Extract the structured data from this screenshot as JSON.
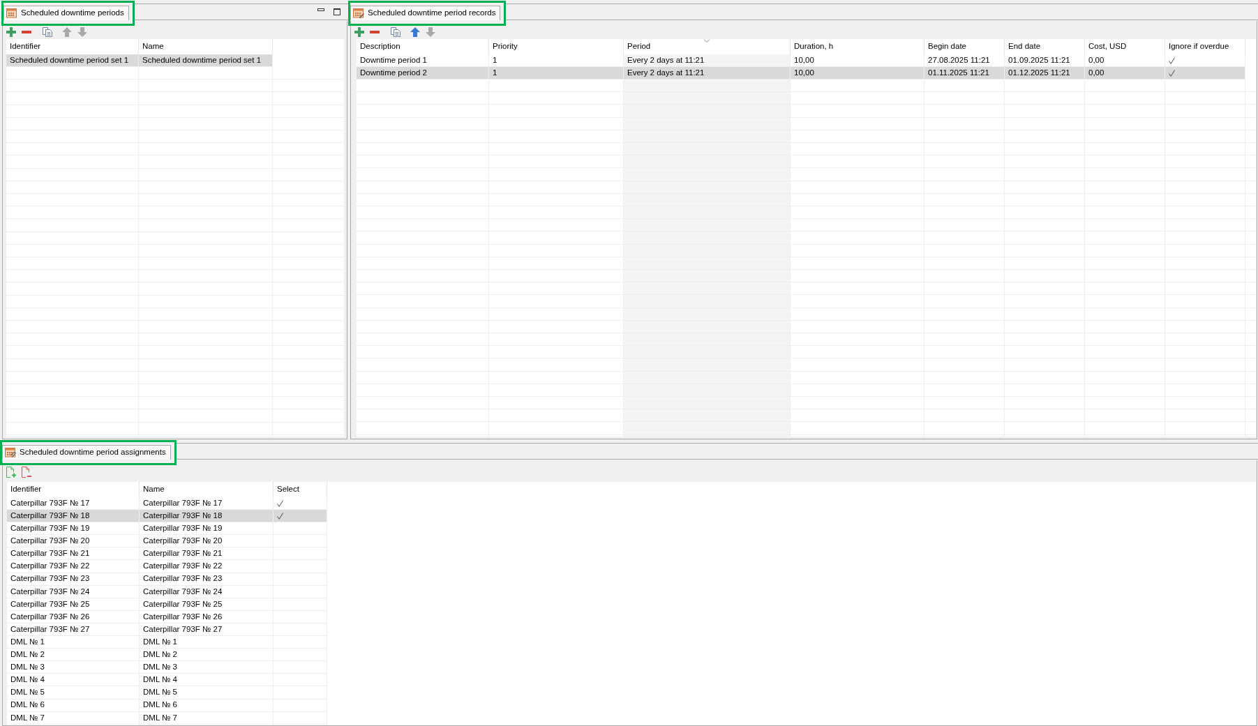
{
  "periods_panel": {
    "tab": {
      "title": "Scheduled downtime periods",
      "highlighted": true
    },
    "toolbar": [
      {
        "kind": "add",
        "disabled": false
      },
      {
        "kind": "remove",
        "disabled": false
      },
      {
        "kind": "copy",
        "disabled": false
      },
      {
        "kind": "move_up",
        "disabled": true
      },
      {
        "kind": "move_down",
        "disabled": true
      }
    ],
    "table": {
      "columns": [
        {
          "label": "Identifier",
          "kind": "text",
          "sorted": false
        },
        {
          "label": "Name",
          "kind": "text",
          "sorted": false
        }
      ],
      "rows": [
        {
          "cells": [
            "Scheduled downtime period set 1",
            "Scheduled downtime period set 1"
          ],
          "selected": true
        }
      ]
    }
  },
  "records_panel": {
    "tab": {
      "title": "Scheduled downtime period records",
      "highlighted": true
    },
    "toolbar": [
      {
        "kind": "add",
        "disabled": false
      },
      {
        "kind": "remove",
        "disabled": false
      },
      {
        "kind": "copy",
        "disabled": false
      },
      {
        "kind": "move_up",
        "disabled": false
      },
      {
        "kind": "move_down",
        "disabled": true
      }
    ],
    "table": {
      "columns": [
        {
          "label": "Description",
          "kind": "text",
          "sorted": false
        },
        {
          "label": "Priority",
          "kind": "text",
          "sorted": false
        },
        {
          "label": "Period",
          "kind": "text",
          "sorted": true
        },
        {
          "label": "Duration, h",
          "kind": "text",
          "sorted": false
        },
        {
          "label": "Begin date",
          "kind": "text",
          "sorted": false
        },
        {
          "label": "End date",
          "kind": "text",
          "sorted": false
        },
        {
          "label": "Cost, USD",
          "kind": "text",
          "sorted": false
        },
        {
          "label": "Ignore if overdue",
          "kind": "check",
          "sorted": false
        }
      ],
      "rows": [
        {
          "cells": [
            "Downtime period 1",
            "1",
            "Every 2 days at 11:21",
            "10,00",
            "27.08.2025 11:21",
            "01.09.2025 11:21",
            "0,00",
            true
          ],
          "selected": false
        },
        {
          "cells": [
            "Downtime period 2",
            "1",
            "Every 2 days at 11:21",
            "10,00",
            "01.11.2025 11:21",
            "01.12.2025 11:21",
            "0,00",
            true
          ],
          "selected": true
        }
      ]
    }
  },
  "assignments_panel": {
    "tab": {
      "title": "Scheduled downtime period assignments",
      "highlighted": true
    },
    "toolbar": [
      {
        "kind": "add_document",
        "disabled": false
      },
      {
        "kind": "remove_document",
        "disabled": false
      }
    ],
    "table": {
      "columns": [
        {
          "label": "Identifier",
          "kind": "text",
          "sorted": false
        },
        {
          "label": "Name",
          "kind": "text",
          "sorted": false
        },
        {
          "label": "Select",
          "kind": "check",
          "sorted": false
        }
      ],
      "rows": [
        {
          "cells": [
            "Caterpillar 793F № 17",
            "Caterpillar 793F № 17",
            true
          ],
          "selected": false
        },
        {
          "cells": [
            "Caterpillar 793F № 18",
            "Caterpillar 793F № 18",
            true
          ],
          "selected": true
        },
        {
          "cells": [
            "Caterpillar 793F № 19",
            "Caterpillar 793F № 19",
            false
          ],
          "selected": false
        },
        {
          "cells": [
            "Caterpillar 793F № 20",
            "Caterpillar 793F № 20",
            false
          ],
          "selected": false
        },
        {
          "cells": [
            "Caterpillar 793F № 21",
            "Caterpillar 793F № 21",
            false
          ],
          "selected": false
        },
        {
          "cells": [
            "Caterpillar 793F № 22",
            "Caterpillar 793F № 22",
            false
          ],
          "selected": false
        },
        {
          "cells": [
            "Caterpillar 793F № 23",
            "Caterpillar 793F № 23",
            false
          ],
          "selected": false
        },
        {
          "cells": [
            "Caterpillar 793F № 24",
            "Caterpillar 793F № 24",
            false
          ],
          "selected": false
        },
        {
          "cells": [
            "Caterpillar 793F № 25",
            "Caterpillar 793F № 25",
            false
          ],
          "selected": false
        },
        {
          "cells": [
            "Caterpillar 793F № 26",
            "Caterpillar 793F № 26",
            false
          ],
          "selected": false
        },
        {
          "cells": [
            "Caterpillar 793F № 27",
            "Caterpillar 793F № 27",
            false
          ],
          "selected": false
        },
        {
          "cells": [
            "DML № 1",
            "DML № 1",
            false
          ],
          "selected": false
        },
        {
          "cells": [
            "DML № 2",
            "DML № 2",
            false
          ],
          "selected": false
        },
        {
          "cells": [
            "DML № 3",
            "DML № 3",
            false
          ],
          "selected": false
        },
        {
          "cells": [
            "DML № 4",
            "DML № 4",
            false
          ],
          "selected": false
        },
        {
          "cells": [
            "DML № 5",
            "DML № 5",
            false
          ],
          "selected": false
        },
        {
          "cells": [
            "DML № 6",
            "DML № 6",
            false
          ],
          "selected": false
        },
        {
          "cells": [
            "DML № 7",
            "DML № 7",
            false
          ],
          "selected": false
        }
      ]
    }
  }
}
